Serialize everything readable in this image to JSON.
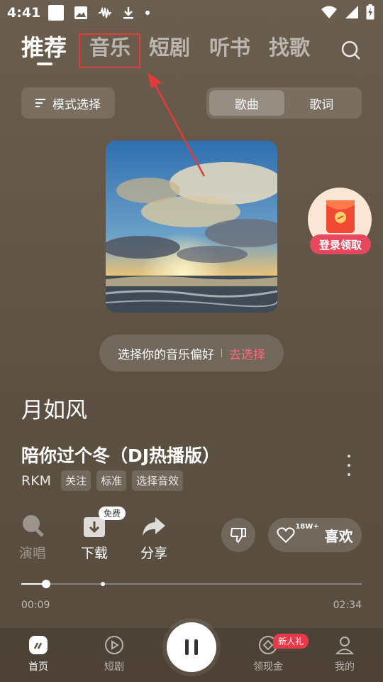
{
  "status_bar": {
    "time": "4:41"
  },
  "top_tabs": [
    "推荐",
    "音乐",
    "短剧",
    "听书",
    "找歌"
  ],
  "mode_select": {
    "label": "模式选择"
  },
  "segment": {
    "song": "歌曲",
    "lyrics": "歌词"
  },
  "promo": {
    "label": "登录领取"
  },
  "preference": {
    "text": "选择你的音乐偏好",
    "action": "去选择"
  },
  "lyric_line": "月如风",
  "song": {
    "title": "陪你过个冬（DJ热播版）",
    "artist": "RKM",
    "chips": [
      "关注",
      "标准",
      "选择音效"
    ]
  },
  "actions": {
    "sing": "演唱",
    "download": "下载",
    "download_badge": "免费",
    "share": "分享",
    "like_count": "18W+",
    "like": "喜欢"
  },
  "progress": {
    "elapsed": "00:09",
    "total": "02:34",
    "played_fraction": 0.073,
    "buffered_fraction": 0.24
  },
  "bottom_nav": {
    "home": "首页",
    "drama": "短剧",
    "cash": "领现金",
    "cash_badge": "新人礼",
    "mine": "我的"
  },
  "colors": {
    "accent_pink": "#ff6a7c",
    "badge_red": "#e83a4a",
    "annotation_red": "#e23b3b"
  }
}
